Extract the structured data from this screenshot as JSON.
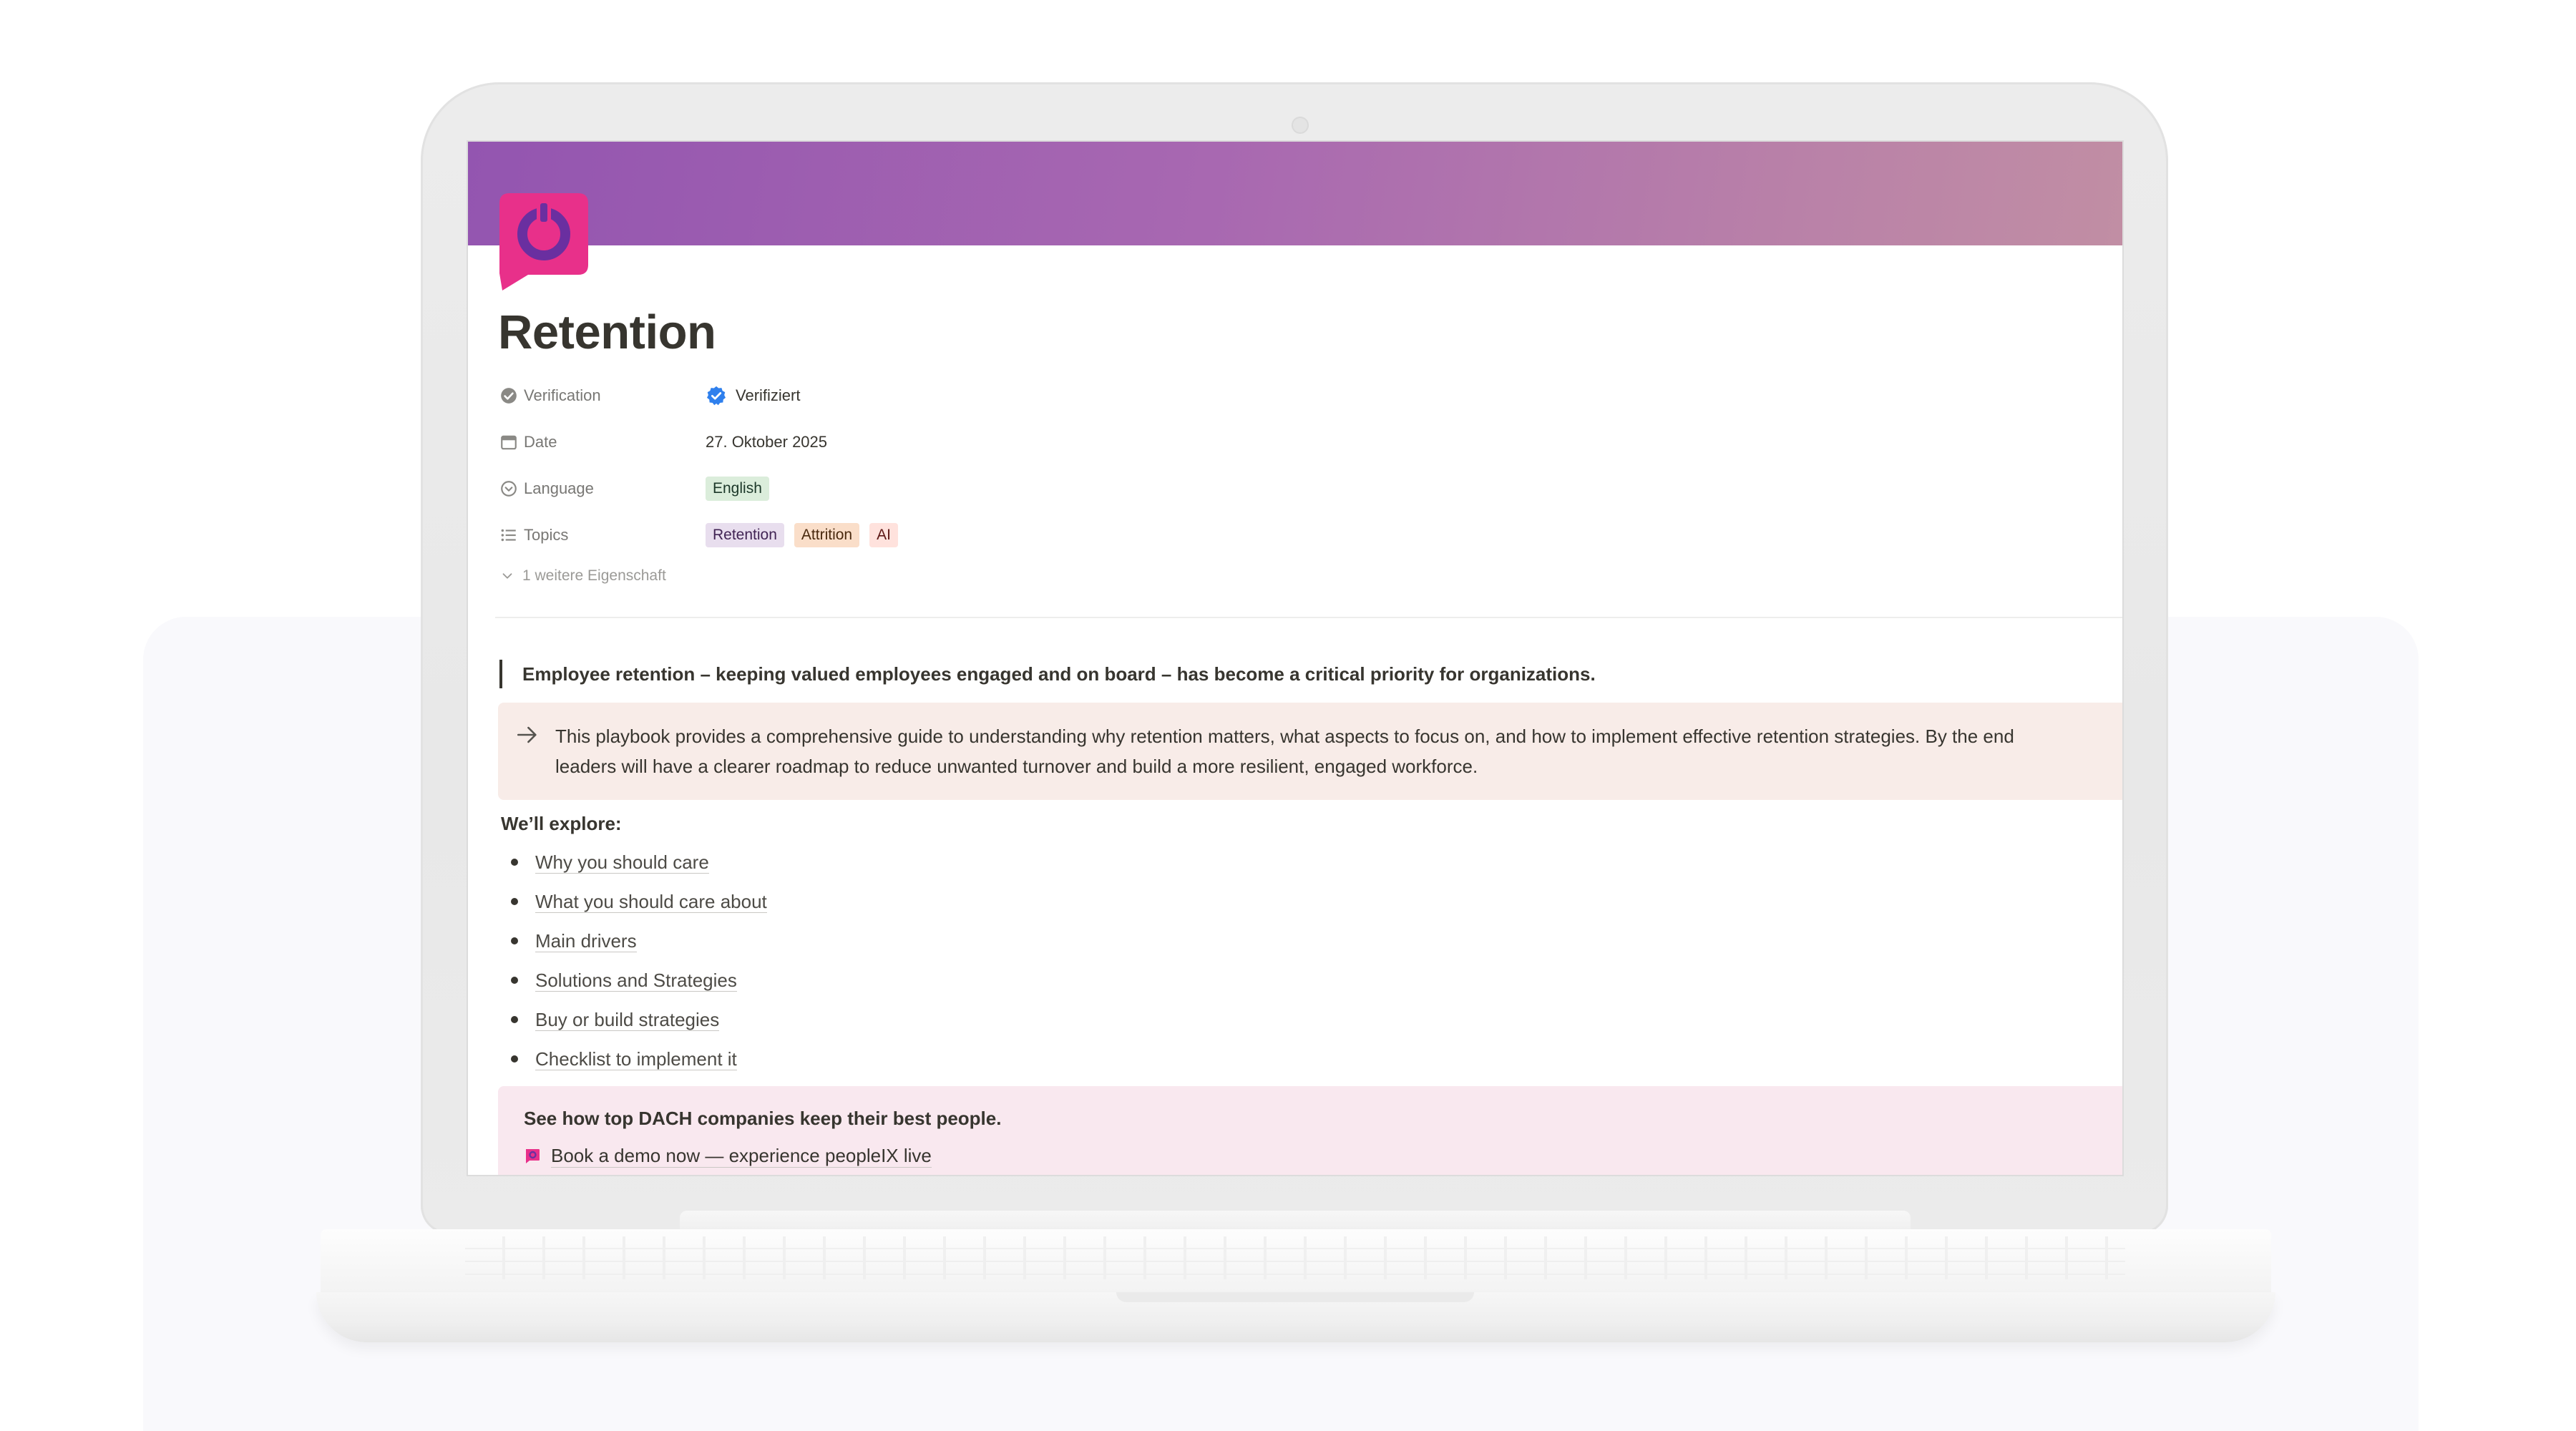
{
  "page": {
    "title": "Retention",
    "icon": "peoplex-logo-icon"
  },
  "properties": [
    {
      "icon": "verified-badge-icon",
      "label": "Verification",
      "value": "Verifiziert"
    },
    {
      "icon": "calendar-icon",
      "label": "Date",
      "value": "27. Oktober 2025"
    },
    {
      "icon": "select-circle-icon",
      "label": "Language",
      "tags": [
        "English"
      ]
    },
    {
      "icon": "list-icon",
      "label": "Topics",
      "tags": [
        "Retention",
        "Attrition",
        "AI"
      ]
    }
  ],
  "more_properties": "1 weitere Eigenschaft",
  "quote": "Employee retention – keeping valued employees engaged and on board – has become a critical priority for organizations.",
  "callout": {
    "icon": "arrow-right-icon",
    "line1": "This playbook provides a comprehensive guide to understanding why retention matters, what aspects to focus on, and how to implement effective retention strategies. By the end",
    "line2": "leaders will have a clearer roadmap to reduce unwanted turnover and build a more resilient, engaged workforce."
  },
  "explore": {
    "heading": "We’ll explore:",
    "items": [
      "Why you should care",
      "What you should care about",
      "Main drivers",
      "Solutions and Strategies",
      "Buy or build strategies",
      "Checklist to implement it"
    ]
  },
  "cta": {
    "title": "See how top DACH companies keep their best people.",
    "link": "Book a demo now — experience peopleIX live"
  },
  "colors": {
    "banner_start": "#9355b0",
    "banner_end": "#c18ea4",
    "logo_pink": "#e8308a",
    "logo_purple": "#6a2fa0",
    "verified_blue": "#2f80ed",
    "callout_bg": "#f8ece8",
    "cta_bg": "#f9e8ef"
  }
}
